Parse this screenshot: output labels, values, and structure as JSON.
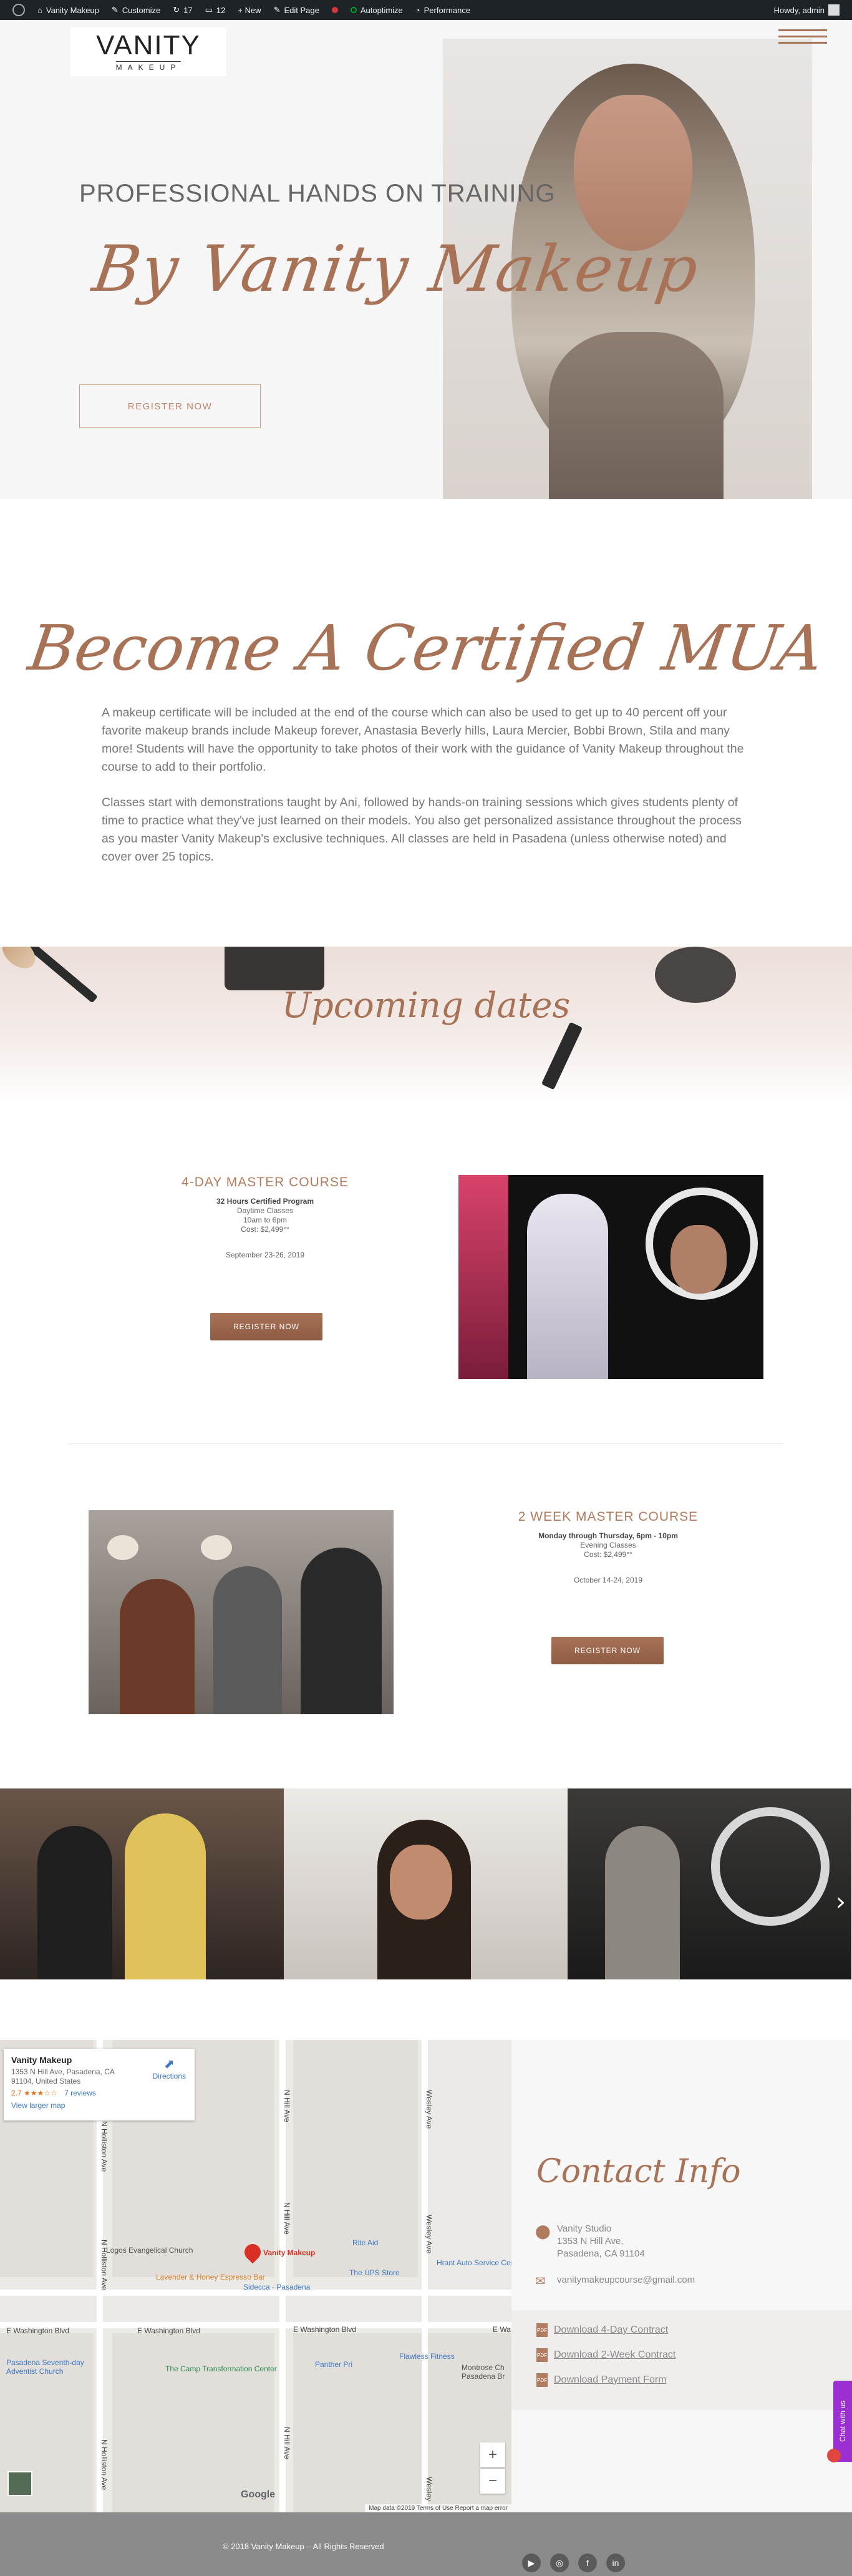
{
  "adminbar": {
    "site_name": "Vanity Makeup",
    "customize": "Customize",
    "updates_count": "17",
    "comments_count": "12",
    "new_label": "+ New",
    "edit_page": "Edit Page",
    "autoptimize": "Autoptimize",
    "performance": "Performance",
    "howdy": "Howdy, admin"
  },
  "header": {
    "logo_main": "VANITY",
    "logo_sub": "MAKEUP"
  },
  "hero": {
    "title": "PROFESSIONAL HANDS ON TRAINING",
    "script": "By Vanity Makeup",
    "button": "REGISTER NOW"
  },
  "certified": {
    "title": "Become A Certified MUA",
    "p1": "A makeup certificate will be included at the end of the course which can also be used to get up to 40 percent off your favorite makeup brands include Makeup forever, Anastasia Beverly hills, Laura Mercier, Bobbi Brown, Stila and many more! Students will have the opportunity to take photos of their work with the guidance of Vanity Makeup throughout the course to add to their portfolio.",
    "p2": "Classes start with demonstrations taught by Ani, followed by hands-on training sessions which gives students plenty of time to practice what they've just learned on their models. You also get personalized assistance throughout the process as you master Vanity Makeup's exclusive techniques. All classes are held in Pasadena (unless otherwise noted) and cover over 25 topics."
  },
  "upcoming": {
    "title": "Upcoming dates"
  },
  "courses": [
    {
      "title": "4-DAY MASTER COURSE",
      "subtitle": "32 Hours Certified Program",
      "line1": "Daytime Classes",
      "line2": "10am to 6pm",
      "cost": "Cost: $2,499°°",
      "dates": "September 23-26, 2019",
      "button": "REGISTER NOW"
    },
    {
      "title": "2 WEEK MASTER COURSE",
      "subtitle": "Monday through Thursday, 6pm - 10pm",
      "line1": "Evening Classes",
      "cost": "Cost: $2,499°°",
      "dates": "October 14-24, 2019",
      "button": "REGISTER NOW"
    }
  ],
  "map": {
    "place_name": "Vanity Makeup",
    "address": "1353 N Hill Ave, Pasadena, CA 91104, United States",
    "rating": "2.7",
    "stars": "★★★☆☆",
    "reviews": "7 reviews",
    "larger_map": "View larger map",
    "directions": "Directions",
    "labels": {
      "logos": "Logos Evangelical Church",
      "lavender": "Lavender & Honey Espresso Bar",
      "sidecca": "Sidecca - Pasadena",
      "vanity": "Vanity Makeup",
      "riteaid": "Rite Aid",
      "ups": "The UPS Store",
      "hrant": "Hrant Auto Service Center",
      "ewash": "E Washington Blvd",
      "ewash2": "E Washington Blvd",
      "ewash3": "E Washington Blvd",
      "ewash4": "E Wa",
      "camp": "The Camp Transformation Center",
      "panther": "Panther Pri",
      "flawless": "Flawless Fitness",
      "montrose": "Montrose Ch Pasadena Br",
      "adventist": "Pasadena Seventh-day Adventist Church",
      "hill": "N Hill Ave",
      "hill2": "N Hill Ave",
      "hill3": "N Hill Ave",
      "holliston": "N Holliston Ave",
      "holliston2": "N Holliston Ave",
      "holliston3": "N Holliston Ave",
      "wesley": "Wesley Ave",
      "wesley2": "Wesley Ave",
      "wesley3": "Wesley"
    },
    "zoom_in": "+",
    "zoom_out": "−",
    "google": "Google",
    "footer": "Map data ©2019   Terms of Use   Report a map error"
  },
  "contact": {
    "title": "Contact Info",
    "studio": "Vanity Studio",
    "street": "1353 N Hill Ave,",
    "city": "Pasadena, CA 91104",
    "email": "vanitymakeupcourse@gmail.com",
    "downloads": [
      "Download 4-Day Contract",
      "Download 2-Week Contract",
      "Download Payment Form"
    ],
    "pdf_badge": "PDF"
  },
  "chat": {
    "label": "Chat with us"
  },
  "footer": {
    "copyright": "© 2018 Vanity Makeup – All Rights Reserved",
    "social": [
      "▶",
      "◎",
      "f",
      "in"
    ]
  },
  "colors": {
    "accent": "#a87256",
    "admin_bg": "#1d2327",
    "footer_bg": "#8b8b8b"
  }
}
